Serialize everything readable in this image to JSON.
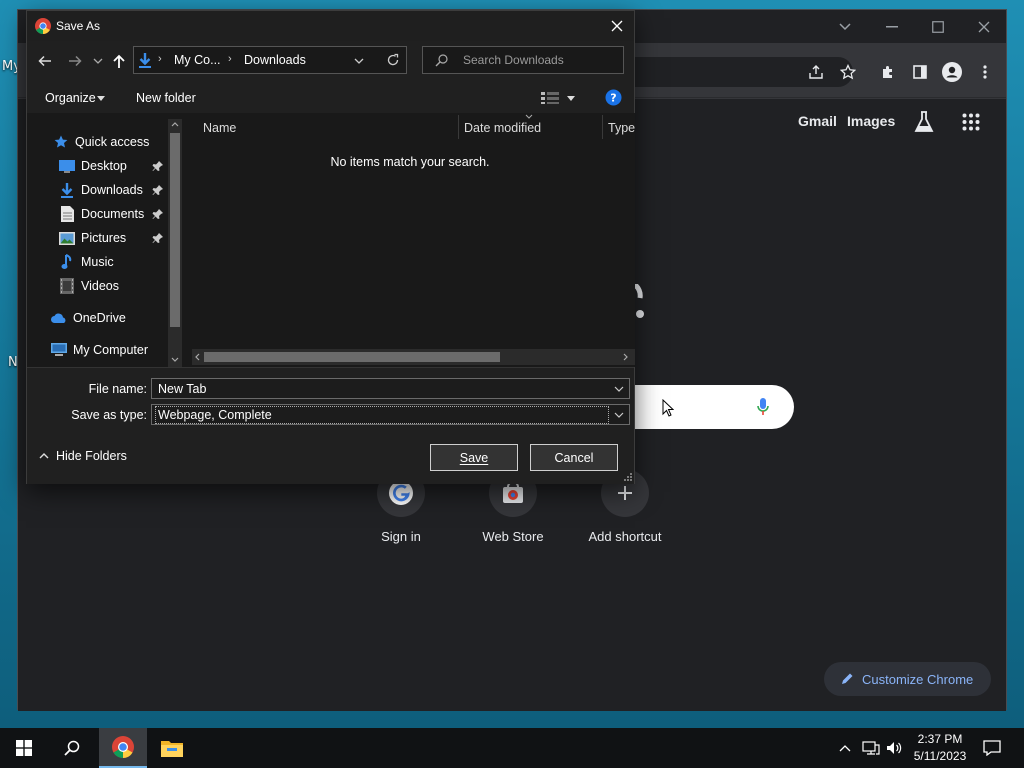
{
  "desktop": {
    "icon_label_1": "My",
    "icon_label_2": "N"
  },
  "chrome": {
    "ntp_links": {
      "gmail": "Gmail",
      "images": "Images"
    },
    "shortcuts": [
      {
        "label": "Sign in",
        "icon": "google-g-icon"
      },
      {
        "label": "Web Store",
        "icon": "chrome-web-store-icon"
      },
      {
        "label": "Add shortcut",
        "icon": "plus-icon"
      }
    ],
    "customize_label": "Customize Chrome"
  },
  "dialog": {
    "title": "Save As",
    "breadcrumb": [
      "My Co...",
      "Downloads"
    ],
    "search_placeholder": "Search Downloads",
    "organize_label": "Organize",
    "new_folder_label": "New folder",
    "nav": {
      "quick_access": "Quick access",
      "items": [
        {
          "label": "Desktop",
          "icon": "desktop-icon",
          "pinned": true
        },
        {
          "label": "Downloads",
          "icon": "download-icon",
          "pinned": true
        },
        {
          "label": "Documents",
          "icon": "documents-icon",
          "pinned": true
        },
        {
          "label": "Pictures",
          "icon": "pictures-icon",
          "pinned": true
        },
        {
          "label": "Music",
          "icon": "music-icon",
          "pinned": false
        },
        {
          "label": "Videos",
          "icon": "videos-icon",
          "pinned": false
        }
      ],
      "onedrive": "OneDrive",
      "my_computer": "My Computer"
    },
    "columns": [
      "Name",
      "Date modified",
      "Type"
    ],
    "empty_message": "No items match your search.",
    "file_name_label": "File name:",
    "file_name_value": "New Tab",
    "save_type_label": "Save as type:",
    "save_type_value": "Webpage, Complete",
    "hide_folders_label": "Hide Folders",
    "save_button": "Save",
    "cancel_button": "Cancel"
  },
  "taskbar": {
    "time": "2:37 PM",
    "date": "5/11/2023"
  },
  "colors": {
    "chrome_bg": "#202124",
    "dialog_bg": "#2b2b2b",
    "accent_link": "#8ab4f8",
    "taskbar_bg": "#101214"
  }
}
